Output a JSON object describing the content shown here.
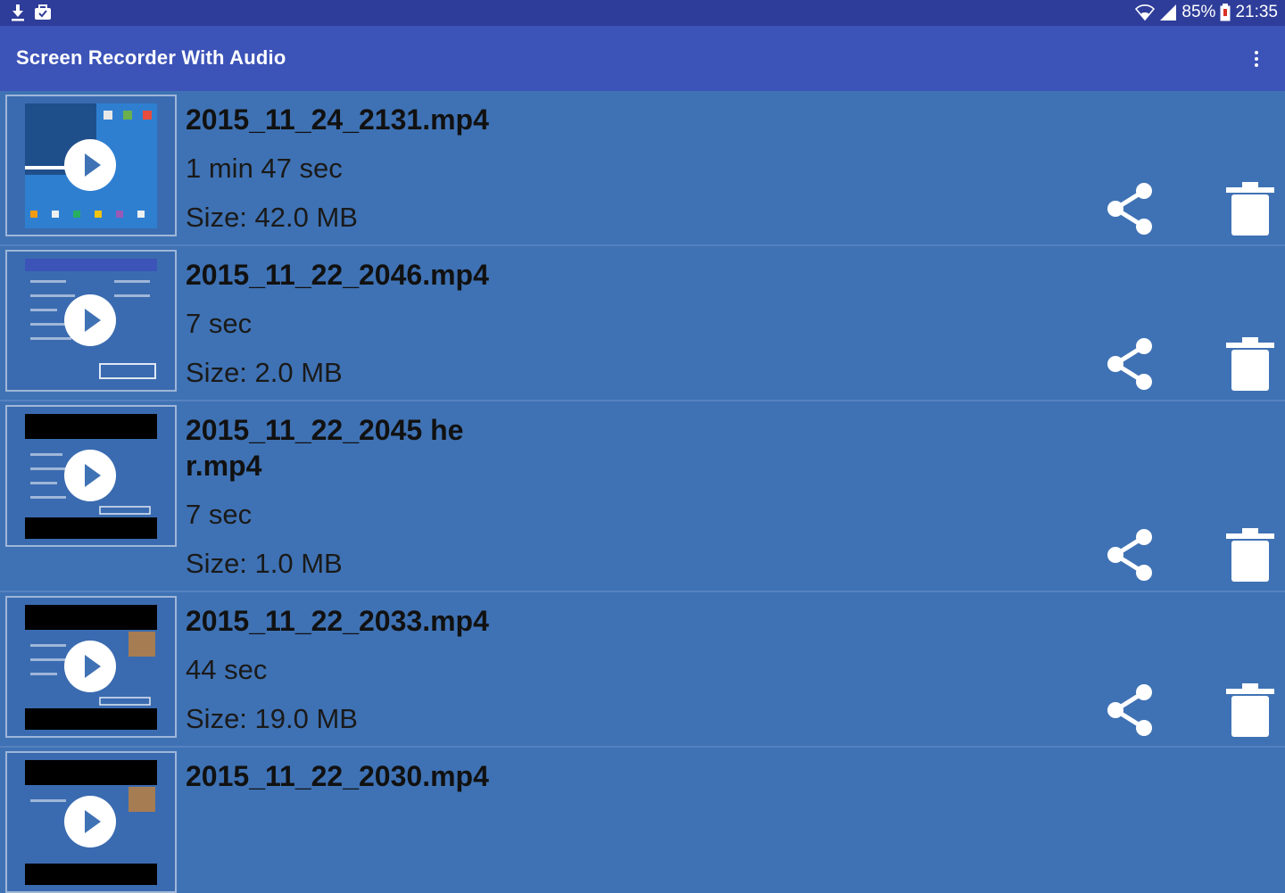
{
  "status_bar": {
    "battery": "85%",
    "time": "21:35",
    "icons": [
      "download-icon",
      "briefcase-icon",
      "wifi-icon",
      "signal-icon",
      "battery-icon"
    ]
  },
  "app_bar": {
    "title": "Screen Recorder With Audio",
    "menu_icon": "more-vert-icon"
  },
  "recordings": [
    {
      "name": "2015_11_24_2131.mp4",
      "duration": "1 min 47 sec",
      "size": "Size: 42.0 MB"
    },
    {
      "name": "2015_11_22_2046.mp4",
      "duration": "7 sec",
      "size": "Size: 2.0 MB"
    },
    {
      "name": "2015_11_22_2045 her.mp4",
      "duration": "7 sec",
      "size": "Size: 1.0 MB"
    },
    {
      "name": "2015_11_22_2033.mp4",
      "duration": "44 sec",
      "size": "Size: 19.0 MB"
    },
    {
      "name": "2015_11_22_2030.mp4",
      "duration": "",
      "size": ""
    }
  ],
  "colors": {
    "status_bar": "#2e3d99",
    "app_bar": "#3c53b8",
    "list_background": "#3f72b4"
  }
}
